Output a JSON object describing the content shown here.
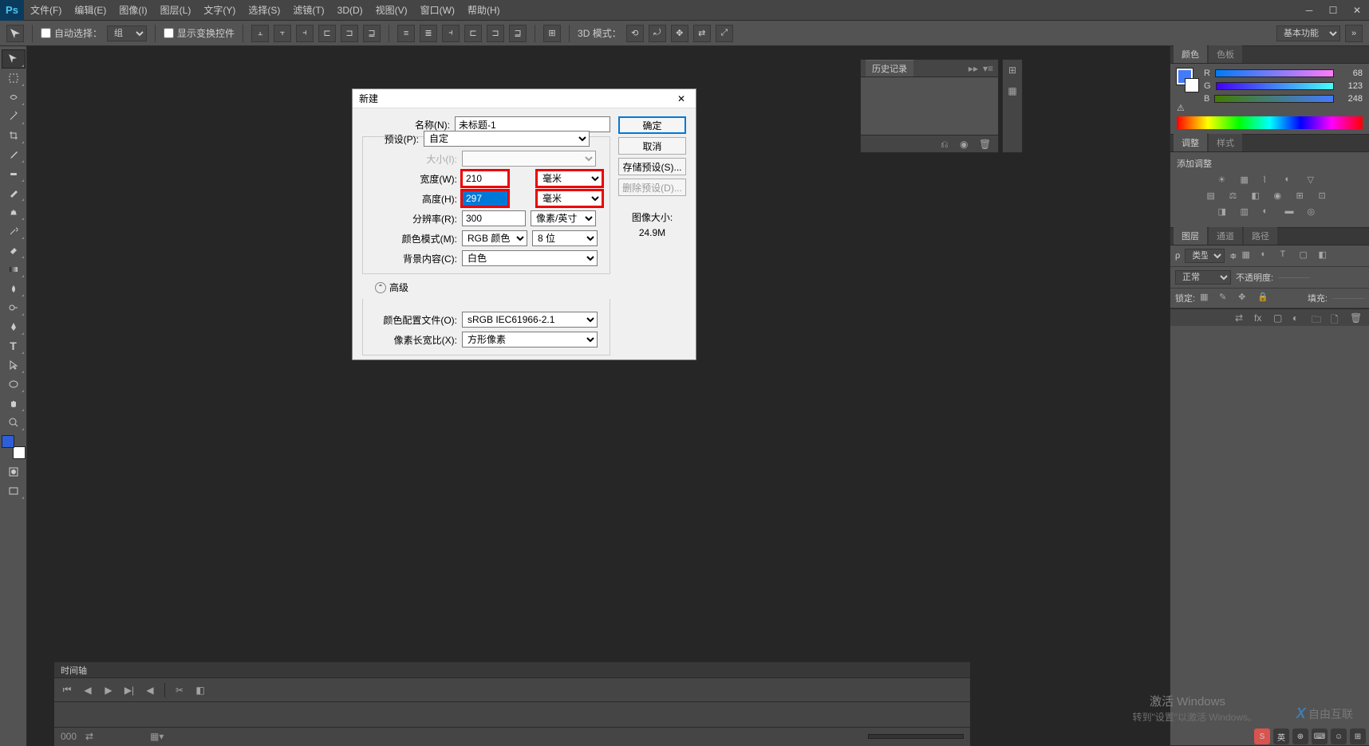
{
  "app": {
    "logo": "Ps"
  },
  "menubar": {
    "items": [
      "文件(F)",
      "编辑(E)",
      "图像(I)",
      "图层(L)",
      "文字(Y)",
      "选择(S)",
      "滤镜(T)",
      "3D(D)",
      "视图(V)",
      "窗口(W)",
      "帮助(H)"
    ]
  },
  "options": {
    "auto_select_label": "自动选择：",
    "auto_select_value": "组",
    "show_transform_label": "显示变换控件",
    "mode_3d": "3D 模式：",
    "workspace": "基本功能"
  },
  "history_panel": {
    "title": "历史记录"
  },
  "dialog": {
    "title": "新建",
    "name_label": "名称(N):",
    "name_value": "未标题-1",
    "preset_label": "预设(P):",
    "preset_value": "自定",
    "size_label": "大小(I):",
    "width_label": "宽度(W):",
    "width_value": "210",
    "width_unit": "毫米",
    "height_label": "高度(H):",
    "height_value": "297",
    "height_unit": "毫米",
    "resolution_label": "分辨率(R):",
    "resolution_value": "300",
    "resolution_unit": "像素/英寸",
    "colormode_label": "颜色模式(M):",
    "colormode_value": "RGB 颜色",
    "colordepth_value": "8 位",
    "bgcontent_label": "背景内容(C):",
    "bgcontent_value": "白色",
    "advanced_label": "高级",
    "profile_label": "颜色配置文件(O):",
    "profile_value": "sRGB IEC61966-2.1",
    "aspect_label": "像素长宽比(X):",
    "aspect_value": "方形像素",
    "ok": "确定",
    "cancel": "取消",
    "save_preset": "存储预设(S)...",
    "delete_preset": "删除预设(D)...",
    "image_size_label": "图像大小:",
    "image_size_value": "24.9M"
  },
  "color_panel": {
    "tab1": "颜色",
    "tab2": "色板",
    "r": "R",
    "g": "G",
    "b": "B",
    "r_val": "68",
    "g_val": "123",
    "b_val": "248"
  },
  "adjust_panel": {
    "tab1": "调整",
    "tab2": "样式",
    "add_label": "添加调整"
  },
  "layers_panel": {
    "tab1": "图层",
    "tab2": "通道",
    "tab3": "路径",
    "kind": "类型",
    "blend": "正常",
    "opacity_label": "不透明度:",
    "lock_label": "锁定:",
    "fill_label": "填充:"
  },
  "timeline": {
    "title": "时间轴"
  },
  "watermark": {
    "activate": "激活 Windows",
    "sub": "转到\"设置\"以激活 Windows。",
    "site": "自由互联"
  },
  "taskbar": {
    "ime": "英"
  }
}
